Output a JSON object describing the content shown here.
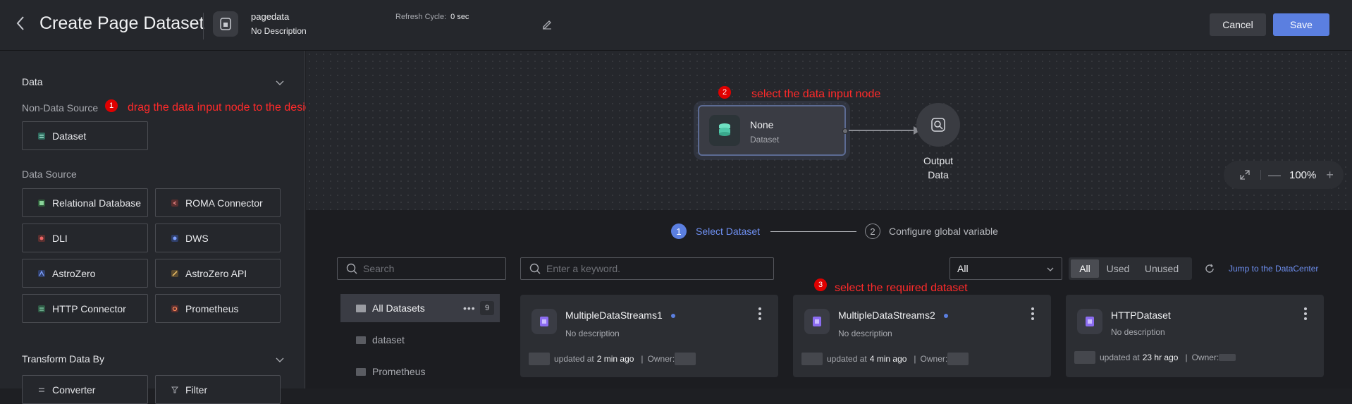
{
  "header": {
    "back_icon": "chevron-left-icon",
    "title": "Create Page Dataset",
    "dataset_name": "pagedata",
    "dataset_desc": "No Description",
    "refresh_label": "Refresh Cycle:",
    "refresh_value": "0 sec",
    "cancel": "Cancel",
    "save": "Save"
  },
  "sidebar": {
    "data_title": "Data",
    "non_data_source": "Non-Data Source",
    "dataset_btn": "Dataset",
    "data_source_title": "Data Source",
    "sources": [
      "Relational Database",
      "ROMA Connector",
      "DLI",
      "DWS",
      "AstroZero",
      "AstroZero API",
      "HTTP Connector",
      "Prometheus"
    ],
    "transform_title": "Transform Data By",
    "transforms": [
      "Converter",
      "Filter"
    ]
  },
  "annotations": {
    "a1": "drag the data input node to the design area",
    "a2": "select the data input node",
    "a3": "select the required dataset",
    "n1": "1",
    "n2": "2",
    "n3": "3"
  },
  "canvas": {
    "node_name": "None",
    "node_type": "Dataset",
    "output_label": "Output Data",
    "zoom": "100%"
  },
  "wizard": {
    "step1_num": "1",
    "step1": "Select Dataset",
    "step2_num": "2",
    "step2": "Configure global variable"
  },
  "filters": {
    "search_placeholder": "Search",
    "keyword_placeholder": "Enter a keyword.",
    "select_value": "All",
    "segments": [
      "All",
      "Used",
      "Unused"
    ],
    "jump": "Jump to the DataCenter"
  },
  "tree": [
    {
      "label": "All Datasets",
      "count": "9"
    },
    {
      "label": "dataset"
    },
    {
      "label": "Prometheus"
    }
  ],
  "cards": [
    {
      "name": "MultipleDataStreams1",
      "desc": "No description",
      "updated_prefix": "updated at",
      "updated": "2 min ago",
      "owner": "Owner:"
    },
    {
      "name": "MultipleDataStreams2",
      "desc": "No description",
      "updated_prefix": "updated at",
      "updated": "4 min ago",
      "owner": "Owner:"
    },
    {
      "name": "HTTPDataset",
      "desc": "No description",
      "updated_prefix": "updated at",
      "updated": "23 hr ago",
      "owner": "Owner:"
    }
  ],
  "colors": {
    "accent": "#5b7fe0",
    "annotation": "#ff2a2a"
  }
}
